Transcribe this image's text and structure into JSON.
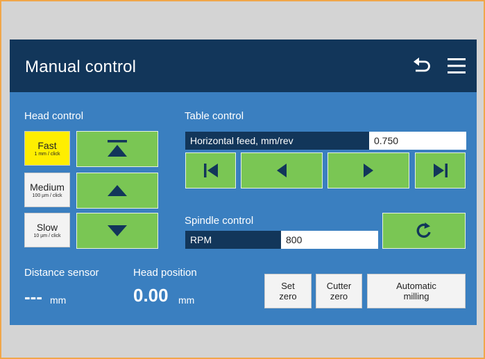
{
  "header": {
    "title": "Manual control",
    "icons": [
      "undo-icon",
      "menu-icon"
    ]
  },
  "head_control": {
    "label": "Head control",
    "speeds": [
      {
        "label": "Fast",
        "sub": "1 mm / click",
        "active": true
      },
      {
        "label": "Medium",
        "sub": "100 µm / click",
        "active": false
      },
      {
        "label": "Slow",
        "sub": "10 µm / click",
        "active": false
      }
    ],
    "buttons": [
      "move-to-top-icon",
      "move-up-icon",
      "move-down-icon"
    ]
  },
  "table_control": {
    "label": "Table control",
    "feed_label": "Horizontal feed, mm/rev",
    "feed_value": "0.750",
    "buttons": [
      "skip-to-start-icon",
      "move-left-icon",
      "move-right-icon",
      "skip-to-end-icon"
    ]
  },
  "spindle_control": {
    "label": "Spindle control",
    "rpm_label": "RPM",
    "rpm_value": "800",
    "button": "rotate-icon"
  },
  "distance_sensor": {
    "label": "Distance sensor",
    "value": "---",
    "unit": "mm"
  },
  "head_position": {
    "label": "Head position",
    "value": "0.00",
    "unit": "mm"
  },
  "actions": {
    "set_zero_l1": "Set",
    "set_zero_l2": "zero",
    "cutter_zero_l1": "Cutter",
    "cutter_zero_l2": "zero",
    "auto_milling_l1": "Automatic",
    "auto_milling_l2": "milling"
  },
  "colors": {
    "header_bg": "#12365a",
    "panel_bg": "#3a7fc0",
    "button_green": "#7ac654",
    "active_yellow": "#ffee00",
    "frame_orange": "#f0a64a"
  }
}
